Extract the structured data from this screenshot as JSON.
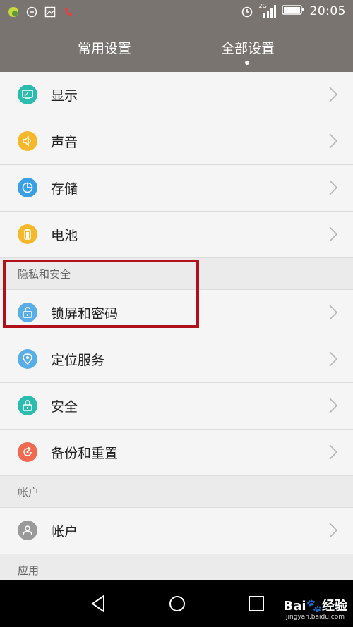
{
  "status": {
    "time": "20:05",
    "network": "2G"
  },
  "tabs": {
    "common": "常用设置",
    "all": "全部设置"
  },
  "rows": {
    "display": "显示",
    "sound": "声音",
    "storage": "存储",
    "battery": "电池",
    "lock": "锁屏和密码",
    "location": "定位服务",
    "security": "安全",
    "backup": "备份和重置",
    "account": "帐户"
  },
  "sections": {
    "privacy": "隐私和安全",
    "accounts": "帐户",
    "apps": "应用"
  },
  "watermark": {
    "main": "Bai",
    "brand": "经验",
    "url": "jingyan.baidu.com"
  },
  "colors": {
    "display": "#2bbcb0",
    "sound": "#f5b82b",
    "storage": "#3aa0e6",
    "battery": "#f5b82b",
    "lock": "#5aaee8",
    "location": "#5aaee8",
    "security": "#2bbcb0",
    "backup": "#f06a4f",
    "account": "#9a9a9a",
    "highlight": "#b0101a"
  }
}
